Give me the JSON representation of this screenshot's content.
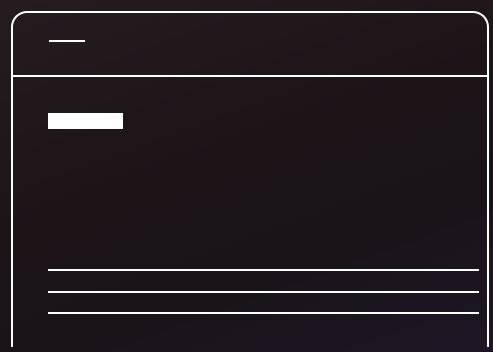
{
  "window": {
    "title": "",
    "heading": "",
    "lines": [
      "",
      "",
      ""
    ]
  },
  "colors": {
    "background": "#1c1417",
    "outline": "#ffffff"
  }
}
